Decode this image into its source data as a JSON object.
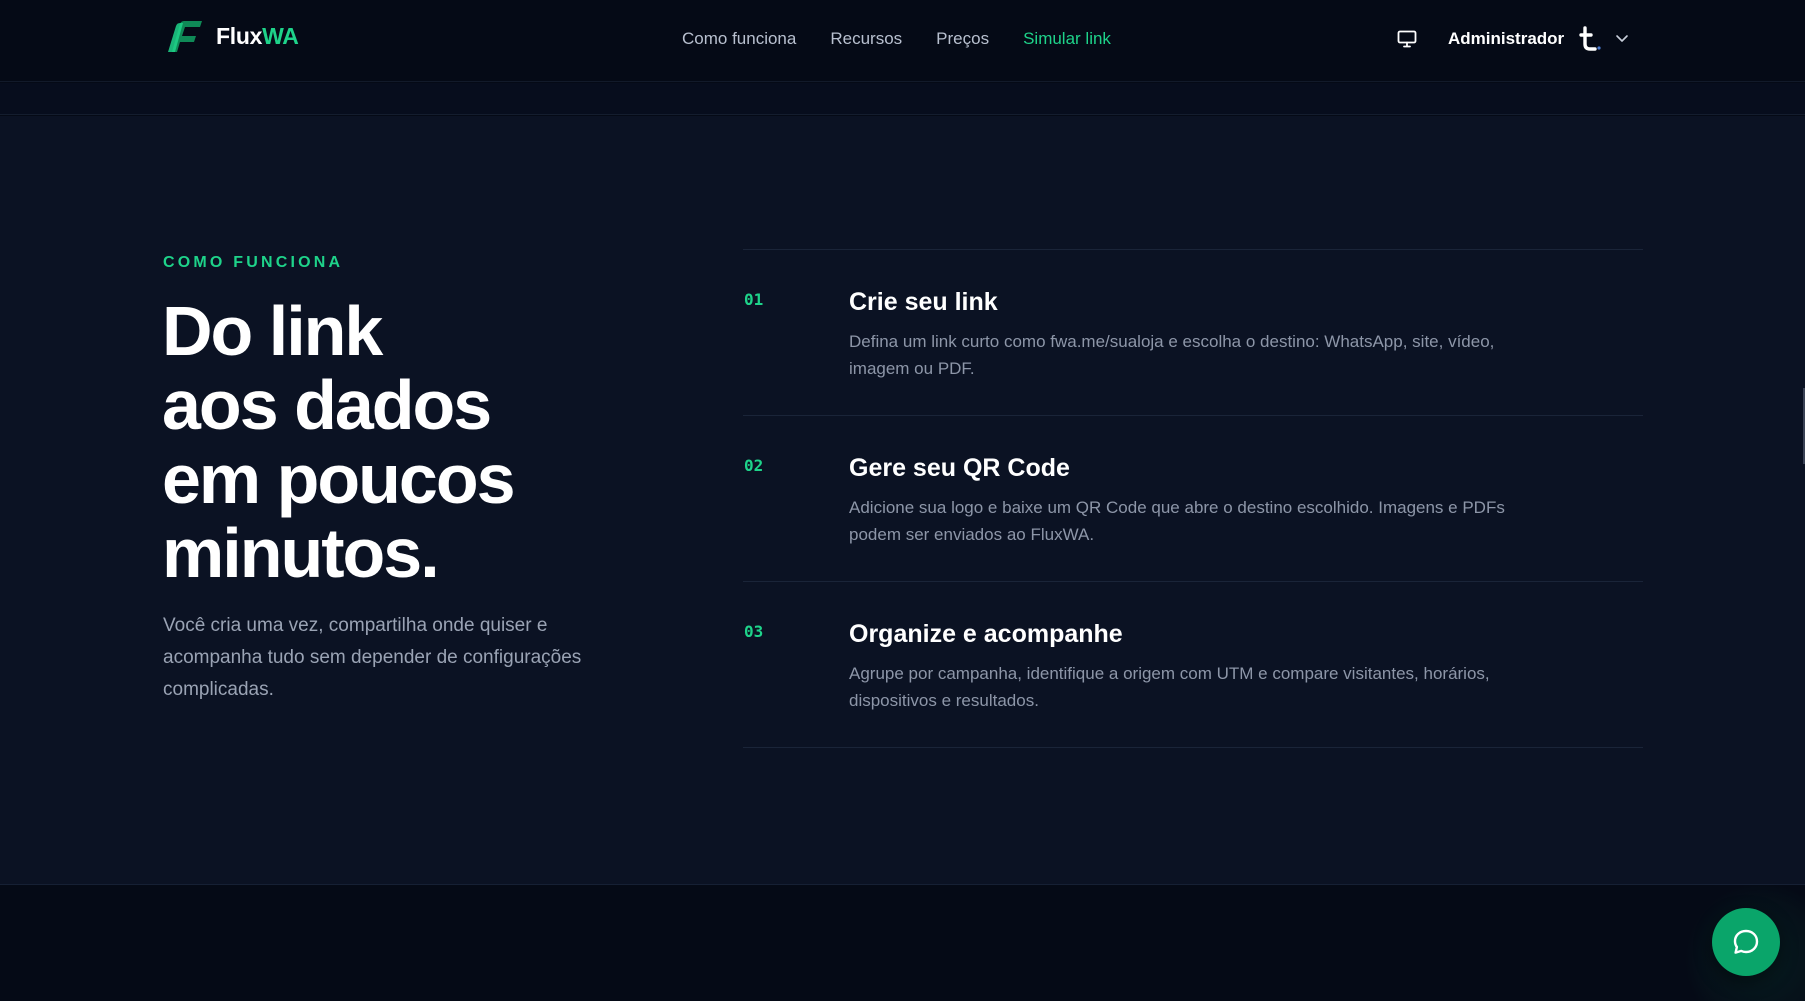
{
  "header": {
    "logo": {
      "flux": "Flux",
      "wa": "WA"
    },
    "nav": [
      {
        "label": "Como funciona",
        "active": false
      },
      {
        "label": "Recursos",
        "active": false
      },
      {
        "label": "Preços",
        "active": false
      },
      {
        "label": "Simular link",
        "active": true
      }
    ],
    "monitor_icon": "monitor-icon",
    "user_name": "Administrador",
    "avatar_icon": "tumblr-t-icon",
    "dropdown_icon": "chevron-down-icon"
  },
  "how_it_works": {
    "eyebrow": "COMO FUNCIONA",
    "headline": [
      "Do link",
      "aos dados",
      "em poucos",
      "minutos."
    ],
    "lead": "Você cria uma vez, compartilha onde quiser e acompanha tudo sem depender de configurações complicadas.",
    "steps": [
      {
        "number": "01",
        "title": "Crie seu link",
        "description": "Defina um link curto como fwa.me/sualoja e escolha o destino: WhatsApp, site, vídeo, imagem ou PDF."
      },
      {
        "number": "02",
        "title": "Gere seu QR Code",
        "description": "Adicione sua logo e baixe um QR Code que abre o destino escolhido. Imagens e PDFs podem ser enviados ao FluxWA."
      },
      {
        "number": "03",
        "title": "Organize e acompanhe",
        "description": "Agrupe por campanha, identifique a origem com UTM e compare visitantes, horários, dispositivos e resultados."
      }
    ]
  },
  "chat_button": {
    "icon": "chat-bubble-icon"
  },
  "colors": {
    "accent": "#1ed38a",
    "background": "#050a16",
    "section": "#0b1223",
    "chat": "#0aa56a"
  }
}
